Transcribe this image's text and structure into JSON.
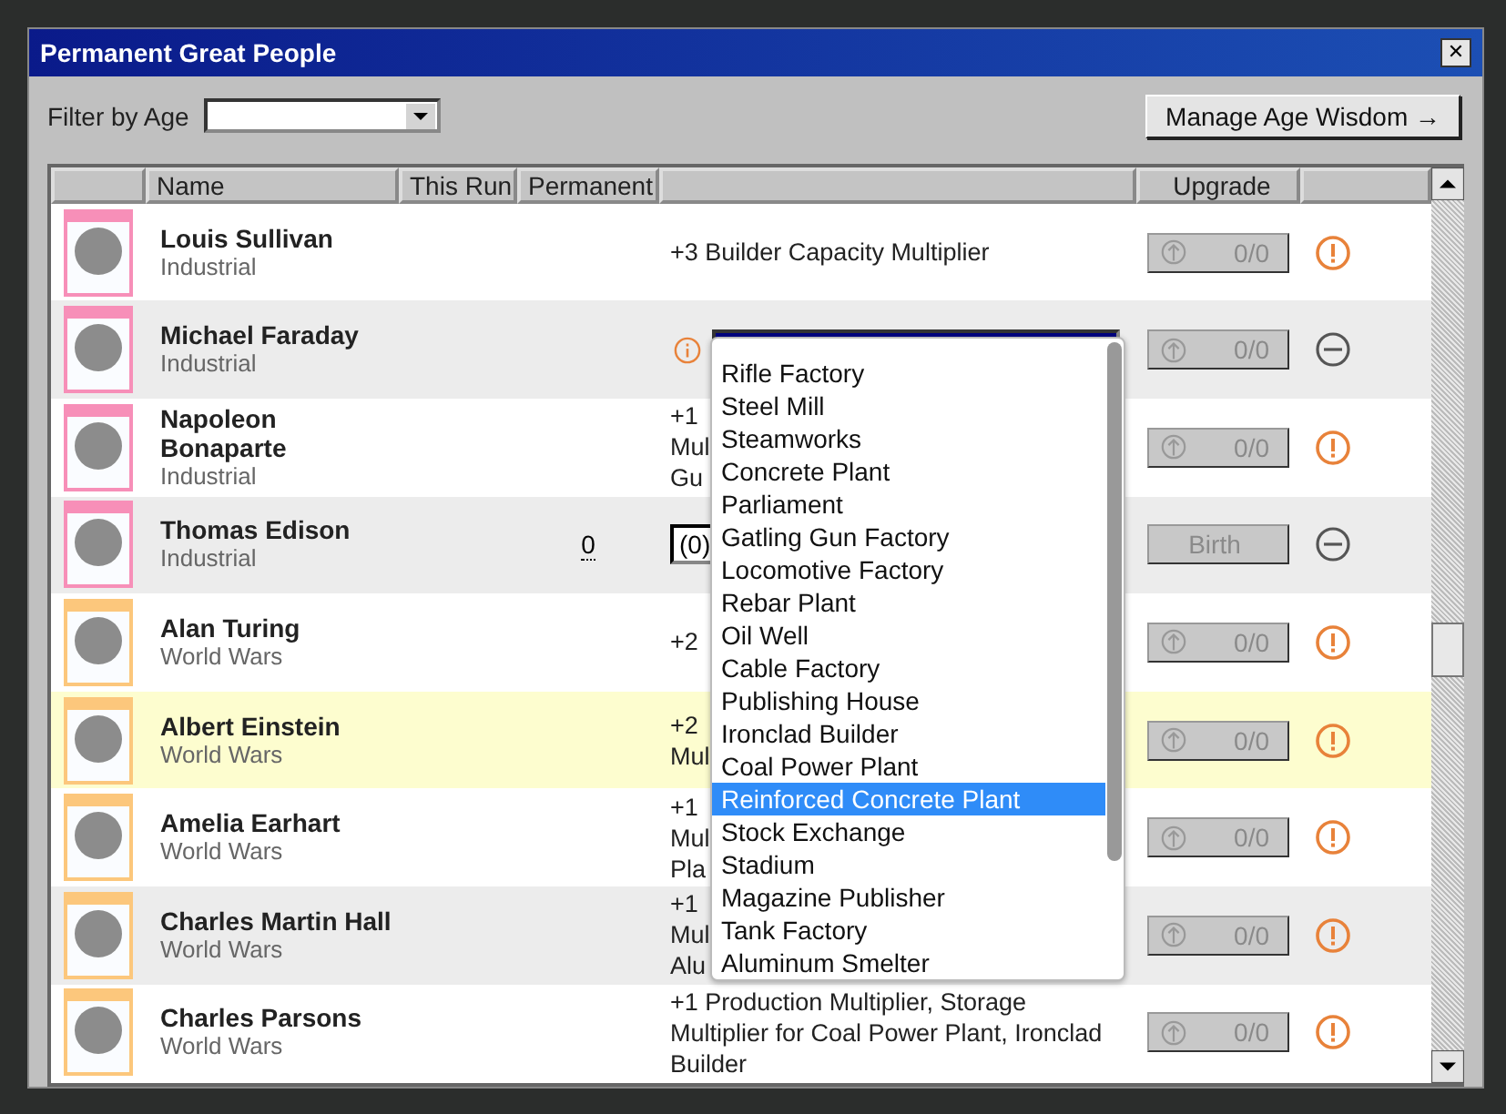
{
  "window": {
    "title": "Permanent Great People",
    "close": "✕"
  },
  "filter": {
    "label": "Filter by Age"
  },
  "manage_button": {
    "label": "Manage Age Wisdom",
    "arrow": "→"
  },
  "table": {
    "columns": [
      "",
      "Name",
      "This Run",
      "Permanent",
      "",
      "Upgrade",
      ""
    ],
    "rows": [
      {
        "name": "Louis Sullivan",
        "age": "Industrial",
        "color": "#f78fb8",
        "highlighted": false,
        "permanent": "",
        "bonus": {
          "kind": "text",
          "lines": [
            "+3 Builder Capacity Multiplier"
          ]
        },
        "upgrade": {
          "kind": "counter",
          "label": "0/0"
        },
        "warning": true
      },
      {
        "name": "Michael Faraday",
        "age": "Industrial",
        "color": "#f78fb8",
        "highlighted": false,
        "permanent": "",
        "bonus": {
          "kind": "select",
          "info": true,
          "open": true
        },
        "upgrade": {
          "kind": "counter",
          "label": "0/0"
        },
        "warning": false
      },
      {
        "name": "Napoleon Bonaparte",
        "age": "Industrial",
        "color": "#f78fb8",
        "highlighted": false,
        "permanent": "",
        "bonus": {
          "kind": "text",
          "lines": [
            "+1",
            "Mul",
            "Gu"
          ]
        },
        "upgrade": {
          "kind": "counter",
          "label": "0/0"
        },
        "warning": true
      },
      {
        "name": "Thomas Edison",
        "age": "Industrial",
        "color": "#f78fb8",
        "highlighted": false,
        "permanent": "0",
        "bonus": {
          "kind": "select",
          "open": false,
          "value": "(0)"
        },
        "upgrade": {
          "kind": "birth",
          "label": "Birth"
        },
        "warning": false
      },
      {
        "name": "Alan Turing",
        "age": "World Wars",
        "color": "#fcc77c",
        "highlighted": false,
        "permanent": "",
        "bonus": {
          "kind": "text",
          "lines": [
            "+2"
          ]
        },
        "upgrade": {
          "kind": "counter",
          "label": "0/0"
        },
        "warning": true
      },
      {
        "name": "Albert Einstein",
        "age": "World Wars",
        "color": "#fcc77c",
        "highlighted": true,
        "permanent": "",
        "bonus": {
          "kind": "text",
          "lines": [
            "+2",
            "Mul"
          ]
        },
        "upgrade": {
          "kind": "counter",
          "label": "0/0"
        },
        "warning": true
      },
      {
        "name": "Amelia Earhart",
        "age": "World Wars",
        "color": "#fcc77c",
        "highlighted": false,
        "permanent": "",
        "bonus": {
          "kind": "text",
          "lines": [
            "+1",
            "Mul",
            "Pla"
          ]
        },
        "upgrade": {
          "kind": "counter",
          "label": "0/0"
        },
        "warning": true
      },
      {
        "name": "Charles Martin Hall",
        "age": "World Wars",
        "color": "#fcc77c",
        "highlighted": false,
        "permanent": "",
        "bonus": {
          "kind": "text",
          "lines": [
            "+1",
            "Mul",
            "Alu"
          ]
        },
        "upgrade": {
          "kind": "counter",
          "label": "0/0"
        },
        "warning": true
      },
      {
        "name": "Charles Parsons",
        "age": "World Wars",
        "color": "#fcc77c",
        "highlighted": false,
        "permanent": "",
        "bonus": {
          "kind": "text",
          "lines": [
            "+1 Production Multiplier, Storage",
            "Multiplier for Coal Power Plant, Ironclad",
            "Builder"
          ]
        },
        "upgrade": {
          "kind": "counter",
          "label": "0/0"
        },
        "warning": true
      }
    ]
  },
  "dropdown": {
    "options": [
      {
        "label": "Rifle Factory",
        "selected": false
      },
      {
        "label": "Steel Mill",
        "selected": false
      },
      {
        "label": "Steamworks",
        "selected": false
      },
      {
        "label": "Concrete Plant",
        "selected": false
      },
      {
        "label": "Parliament",
        "selected": false
      },
      {
        "label": "Gatling Gun Factory",
        "selected": false
      },
      {
        "label": "Locomotive Factory",
        "selected": false
      },
      {
        "label": "Rebar Plant",
        "selected": false
      },
      {
        "label": "Oil Well",
        "selected": false
      },
      {
        "label": "Cable Factory",
        "selected": false
      },
      {
        "label": "Publishing House",
        "selected": false
      },
      {
        "label": "Ironclad Builder",
        "selected": false
      },
      {
        "label": "Coal Power Plant",
        "selected": false
      },
      {
        "label": "Reinforced Concrete Plant",
        "selected": true
      },
      {
        "label": "Stock Exchange",
        "selected": false
      },
      {
        "label": "Stadium",
        "selected": false
      },
      {
        "label": "Magazine Publisher",
        "selected": false
      },
      {
        "label": "Tank Factory",
        "selected": false
      },
      {
        "label": "Aluminum Smelter",
        "selected": false
      }
    ]
  }
}
